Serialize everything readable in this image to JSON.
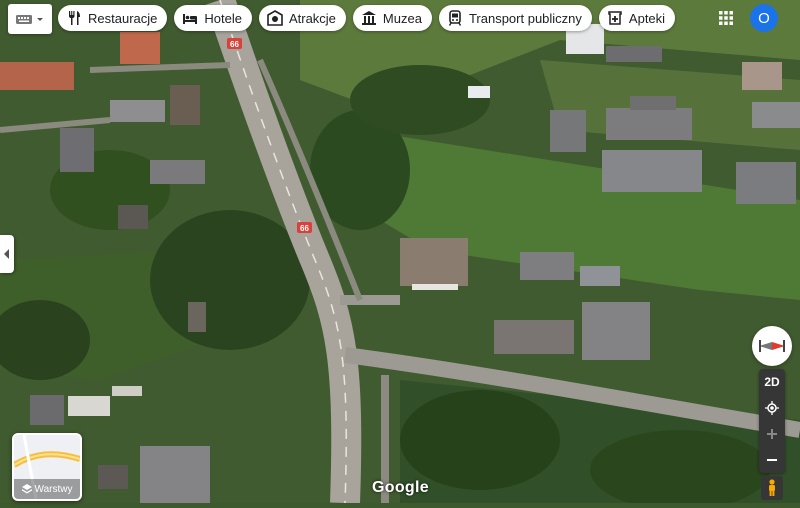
{
  "toolbar": {
    "categories": [
      {
        "label": "Restauracje",
        "icon": "restaurant-icon"
      },
      {
        "label": "Hotele",
        "icon": "hotel-icon"
      },
      {
        "label": "Atrakcje",
        "icon": "attraction-icon"
      },
      {
        "label": "Muzea",
        "icon": "museum-icon"
      },
      {
        "label": "Transport publiczny",
        "icon": "transit-icon"
      },
      {
        "label": "Apteki",
        "icon": "pharmacy-icon"
      }
    ]
  },
  "account": {
    "initial": "O"
  },
  "map": {
    "route_labels": [
      "66",
      "66"
    ],
    "attribution": "Google"
  },
  "layers": {
    "label": "Warstwy"
  },
  "controls": {
    "view_mode": "2D"
  }
}
